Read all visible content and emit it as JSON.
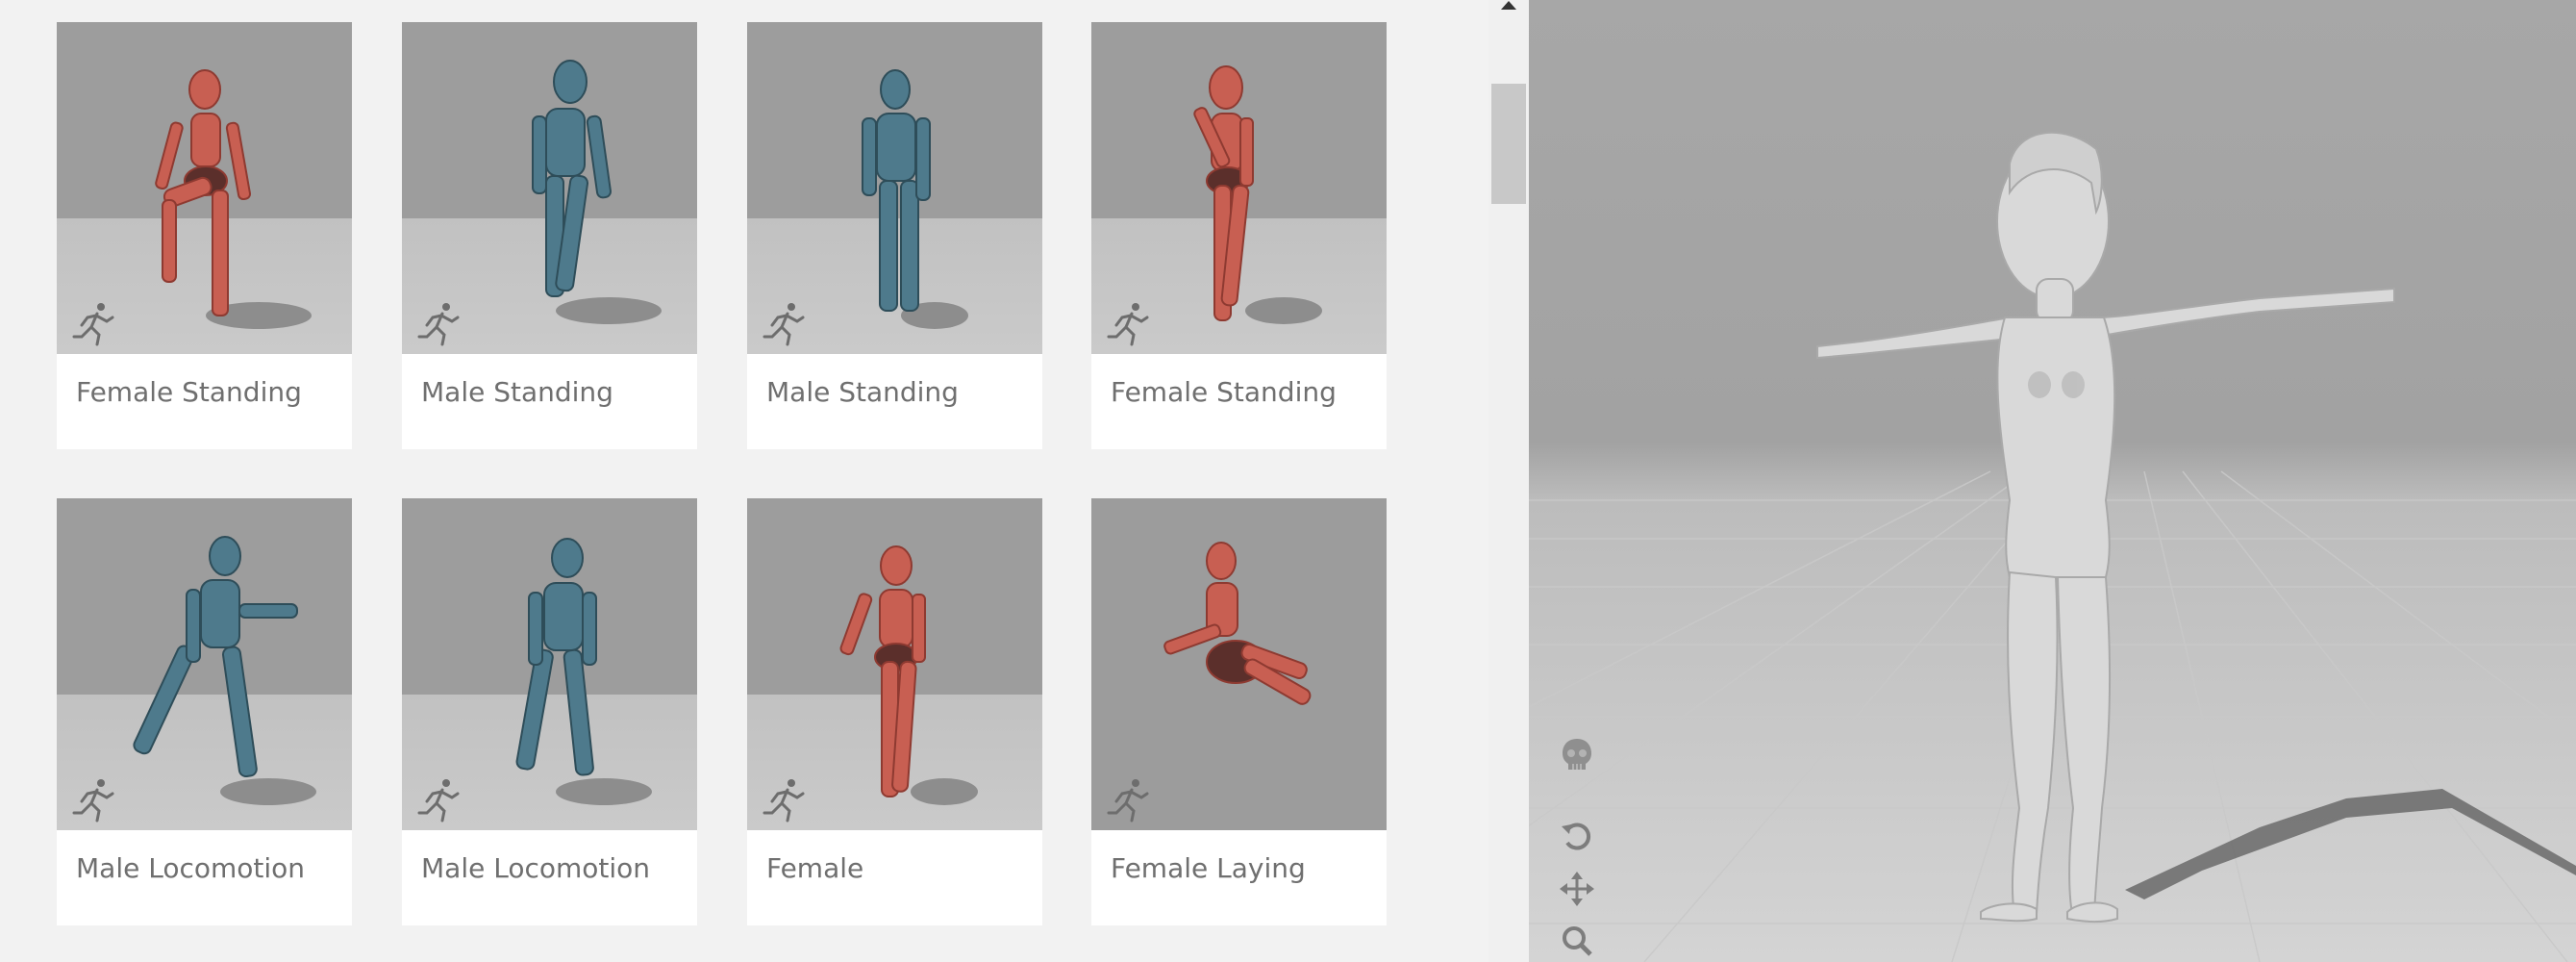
{
  "browser": {
    "cards": [
      {
        "label": "Female Standing",
        "tone": "female"
      },
      {
        "label": "Male Standing",
        "tone": "male"
      },
      {
        "label": "Male Standing",
        "tone": "male"
      },
      {
        "label": "Female Standing",
        "tone": "female"
      },
      {
        "label": "Male Locomotion",
        "tone": "male"
      },
      {
        "label": "Male Locomotion",
        "tone": "male"
      },
      {
        "label": "Female",
        "tone": "female"
      },
      {
        "label": "Female Laying",
        "tone": "female"
      }
    ],
    "card_icon": "running-figure-icon"
  },
  "colors": {
    "female": "#c85f52",
    "male": "#4e7a8c",
    "thumb_bg": "#9d9d9d",
    "floor": "#c4c4c4"
  },
  "viewport": {
    "tools": [
      "skeleton-icon",
      "rotate-icon",
      "pan-icon",
      "zoom-icon"
    ]
  }
}
